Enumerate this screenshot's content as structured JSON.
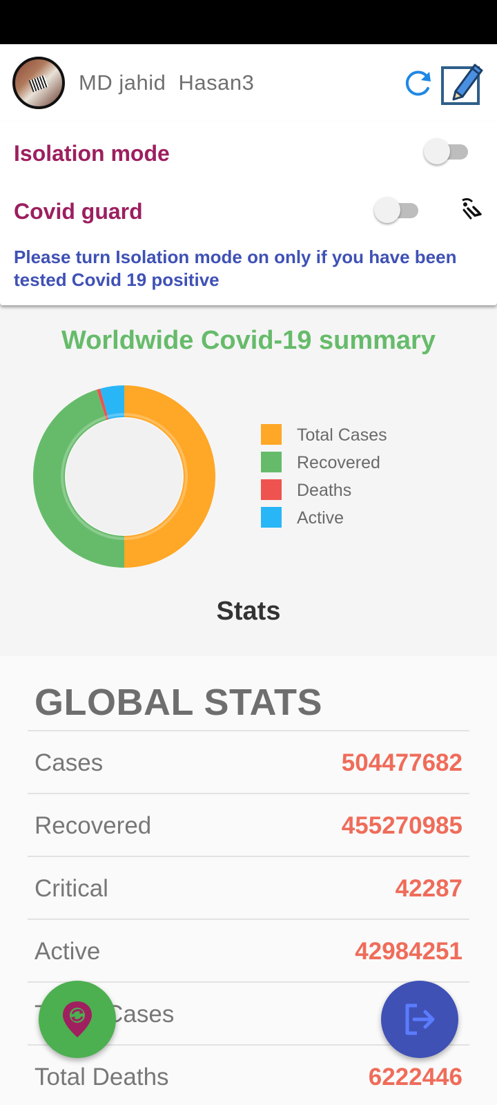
{
  "header": {
    "user_name": "MD jahid  Hasan3"
  },
  "settings": {
    "isolation_label": "Isolation mode",
    "isolation_on": false,
    "guard_label": "Covid guard",
    "guard_on": false,
    "notice": "Please turn Isolation mode on only if you have been tested Covid 19 positive"
  },
  "summary": {
    "title": "Worldwide Covid-19 summary"
  },
  "chart_data": {
    "type": "pie",
    "title": "Worldwide Covid-19 summary",
    "categories": [
      "Total Cases",
      "Recovered",
      "Deaths",
      "Active"
    ],
    "values": [
      504477682,
      455270985,
      6222446,
      42984251
    ],
    "colors": [
      "#ffa726",
      "#66bb6a",
      "#ef5350",
      "#29b6f6"
    ],
    "legend": "right",
    "donut": true
  },
  "stats": {
    "heading": "Stats",
    "global_title": "GLOBAL STATS",
    "rows": [
      {
        "label": "Cases",
        "value": "504477682"
      },
      {
        "label": "Recovered",
        "value": "455270985"
      },
      {
        "label": "Critical",
        "value": "42287"
      },
      {
        "label": "Active",
        "value": "42984251"
      },
      {
        "label": "Today Cases",
        "value": ""
      },
      {
        "label": "Total Deaths",
        "value": "6222446"
      }
    ]
  },
  "colors": {
    "accent_magenta": "#9c1f5f",
    "notice_blue": "#3f51b5",
    "summary_green": "#66bb6a",
    "value_red": "#ef6c5a",
    "fab_green": "#4caf50",
    "fab_blue": "#3f51b5"
  },
  "icons": {
    "refresh": "refresh-icon",
    "edit": "edit-icon",
    "guard": "signal-icon",
    "location": "location-sync-icon",
    "logout": "logout-icon"
  }
}
